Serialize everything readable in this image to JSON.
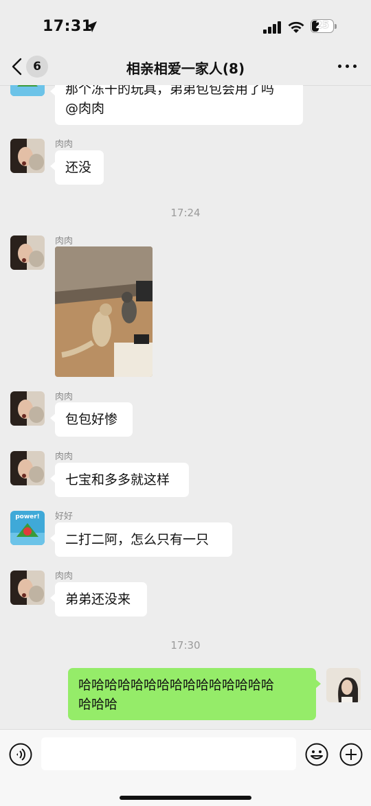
{
  "status_bar": {
    "time": "17:31",
    "battery": "25"
  },
  "header": {
    "back_count": "6",
    "title": "相亲相爱一家人(8)"
  },
  "messages": [
    {
      "sender": "",
      "text": "那个冻干的玩具，弟弟包包会用了吗\n@肉肉"
    },
    {
      "sender": "肉肉",
      "text": "还没"
    },
    {
      "timestamp": "17:24"
    },
    {
      "sender": "肉肉",
      "image": "cats-photo"
    },
    {
      "sender": "肉肉",
      "text": "包包好惨"
    },
    {
      "sender": "肉肉",
      "text": "七宝和多多就这样"
    },
    {
      "sender": "好好",
      "text": "二打二阿，怎么只有一只",
      "avatar_label": "power!"
    },
    {
      "sender": "肉肉",
      "text": "弟弟还没来"
    },
    {
      "timestamp": "17:30"
    },
    {
      "sender": "self",
      "text": "哈哈哈哈哈哈哈哈哈哈哈哈哈哈哈\n哈哈哈"
    }
  ],
  "input_bar": {
    "icons": [
      "voice-icon",
      "emoji-icon",
      "plus-icon"
    ]
  },
  "colors": {
    "background": "#ededed",
    "self_bubble": "#95ec69",
    "other_bubble": "#ffffff"
  }
}
